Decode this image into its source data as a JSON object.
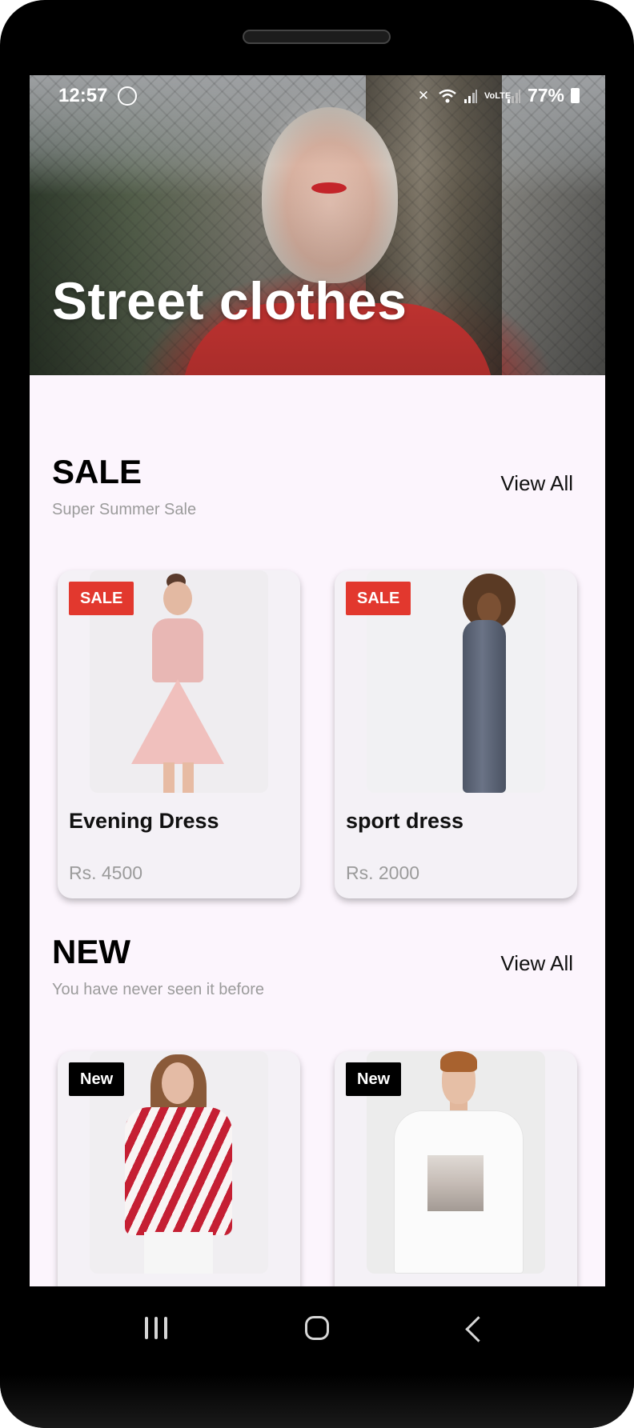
{
  "status_bar": {
    "time": "12:57",
    "battery_percent": "77%",
    "icons": [
      "whatsapp-icon",
      "mute-icon",
      "wifi-icon",
      "signal-icon",
      "volte-icon",
      "signal-icon",
      "battery-charging-icon"
    ]
  },
  "hero": {
    "title": "Street clothes"
  },
  "sale_section": {
    "title": "SALE",
    "subtitle": "Super Summer Sale",
    "view_all": "View All",
    "products": [
      {
        "badge": "SALE",
        "name": "Evening Dress",
        "price": "Rs. 4500"
      },
      {
        "badge": "SALE",
        "name": "sport dress",
        "price": "Rs. 2000"
      }
    ]
  },
  "new_section": {
    "title": "NEW",
    "subtitle": "You have never seen it before",
    "view_all": "View All",
    "products": [
      {
        "badge": "New"
      },
      {
        "badge": "New"
      }
    ]
  },
  "nav_bar": {
    "icons": [
      "recent-apps-icon",
      "home-icon",
      "back-icon"
    ]
  },
  "colors": {
    "background": "#fcf5fd",
    "sale_badge": "#e2382e",
    "new_badge": "#000000",
    "muted_text": "#9b9b9b"
  }
}
